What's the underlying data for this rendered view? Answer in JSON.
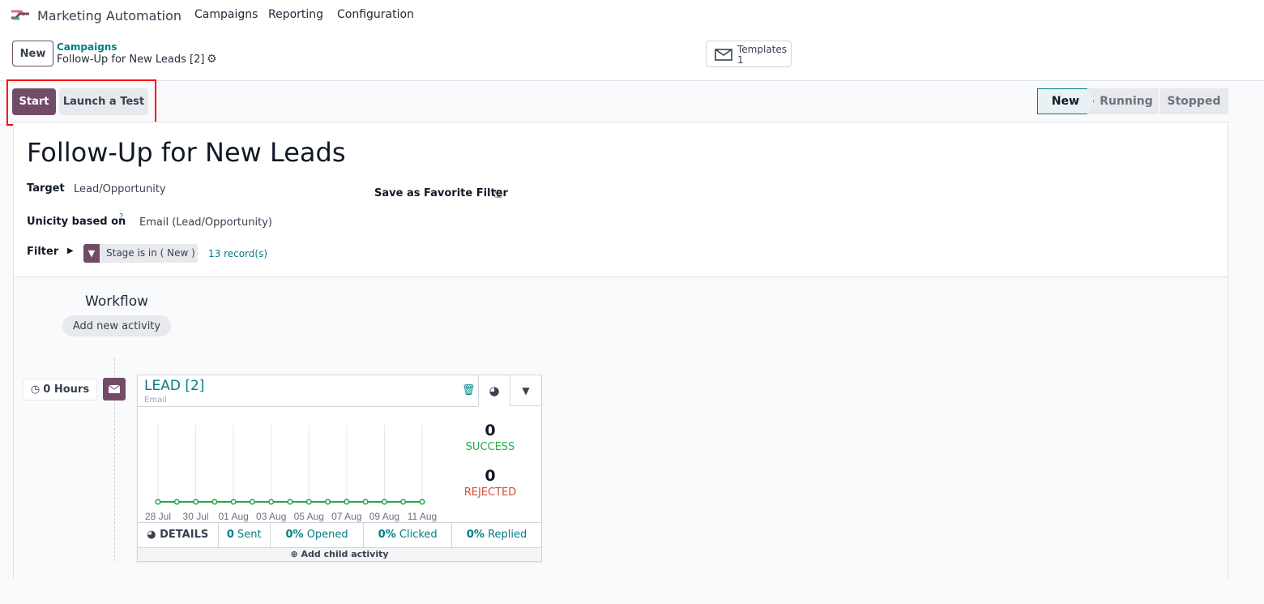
{
  "app": {
    "title": "Marketing Automation",
    "menu": [
      "Campaigns",
      "Reporting",
      "Configuration"
    ]
  },
  "control": {
    "new_label": "New",
    "breadcrumb_parent": "Campaigns",
    "breadcrumb_current": "Follow-Up for New Leads [2]",
    "templates_label": "Templates",
    "templates_count": "1"
  },
  "actions": {
    "start": "Start",
    "test": "Launch a Test"
  },
  "status": {
    "stages": [
      "New",
      "Running",
      "Stopped"
    ],
    "active": "New"
  },
  "form": {
    "title": "Follow-Up for New Leads",
    "target_label": "Target",
    "target_value": "Lead/Opportunity",
    "unicity_label": "Unicity based on",
    "unicity_help": "?",
    "unicity_value": "Email (Lead/Opportunity)",
    "filter_label": "Filter",
    "filter_tag": "Stage is in ( New )",
    "records": "13 record(s)",
    "save_filter": "Save as Favorite Filter"
  },
  "workflow": {
    "title": "Workflow",
    "add_activity": "Add new activity",
    "trigger": "0 Hours",
    "activity": {
      "name": "LEAD [2]",
      "type": "Email",
      "success_count": "0",
      "success_label": "SUCCESS",
      "rejected_count": "0",
      "rejected_label": "REJECTED",
      "details": "DETAILS",
      "sent_n": "0",
      "sent": "Sent",
      "opened_n": "0%",
      "opened": "Opened",
      "clicked_n": "0%",
      "clicked": "Clicked",
      "replied_n": "0%",
      "replied": "Replied",
      "add_child": "Add child activity"
    }
  },
  "chart_data": {
    "type": "line",
    "x": [
      "28 Jul",
      "29 Jul",
      "30 Jul",
      "31 Jul",
      "01 Aug",
      "02 Aug",
      "03 Aug",
      "04 Aug",
      "05 Aug",
      "06 Aug",
      "07 Aug",
      "08 Aug",
      "09 Aug",
      "10 Aug",
      "11 Aug"
    ],
    "tick_labels": [
      "28 Jul",
      "30 Jul",
      "01 Aug",
      "03 Aug",
      "05 Aug",
      "07 Aug",
      "09 Aug",
      "11 Aug"
    ],
    "series": [
      {
        "name": "Success",
        "color": "#28a745",
        "values": [
          0,
          0,
          0,
          0,
          0,
          0,
          0,
          0,
          0,
          0,
          0,
          0,
          0,
          0,
          0
        ]
      }
    ]
  }
}
